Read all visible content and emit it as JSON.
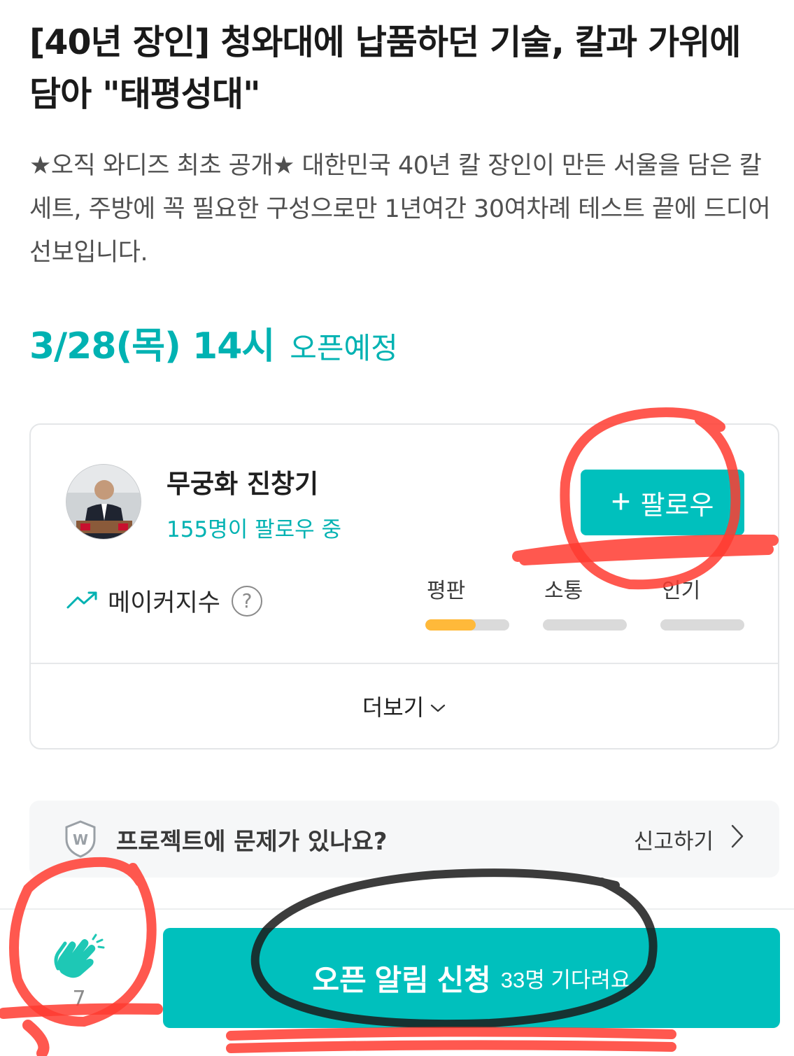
{
  "project": {
    "title": "[40년 장인] 청와대에 납품하던 기술, 칼과 가위에 담아 \"태평성대\"",
    "description": "★오직 와디즈 최초 공개★ 대한민국 40년 칼 장인이 만든 서울을 담은 칼세트, 주방에 꼭 필요한 구성으로만 1년여간 30여차례 테스트 끝에 드디어 선보입니다.",
    "open_date": "3/28(목) 14시",
    "open_label": "오픈예정"
  },
  "maker": {
    "name": "무궁화 진창기",
    "followers": "155명이 팔로우 중",
    "follow_label": "팔로우",
    "index_label": "메이커지수",
    "help_symbol": "?",
    "metrics": [
      {
        "label": "평판",
        "level": 0.6
      },
      {
        "label": "소통",
        "level": 0
      },
      {
        "label": "인기",
        "level": 0
      }
    ],
    "more_label": "더보기"
  },
  "report": {
    "question": "프로젝트에 문제가 있나요?",
    "link_label": "신고하기",
    "shield_letter": "W"
  },
  "bottom": {
    "clap_count": "7",
    "notify_label": "오픈 알림 신청",
    "notify_sub": "33명 기다려요"
  },
  "colors": {
    "accent": "#00c0bd",
    "accent_text": "#00b2b2",
    "metric_fill": "#ffb93a",
    "annotation_red": "#ff3b30",
    "annotation_black": "#1a1a1a"
  },
  "icons": [
    "trend-up-icon",
    "help-icon",
    "plus-icon",
    "chevron-down-icon",
    "shield-icon",
    "chevron-right-icon",
    "clap-icon"
  ]
}
